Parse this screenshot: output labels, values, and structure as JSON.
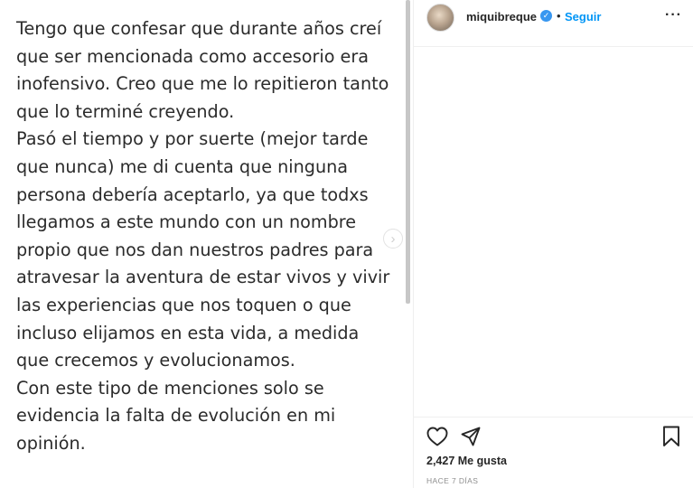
{
  "post": {
    "text_lines": [
      "Tengo que confesar que durante años creí",
      "que ser mencionada como accesorio era",
      "inofensivo. Creo que me lo repitieron tanto",
      "que lo terminé creyendo.",
      "Pasó el tiempo y por suerte (mejor tarde",
      "que nunca) me di cuenta que ninguna",
      "persona debería aceptarlo, ya que todxs",
      "llegamos a este mundo con un nombre",
      "propio que nos dan nuestros padres para",
      "atravesar la aventura de estar vivos y vivir",
      "las experiencias que nos toquen o que",
      "incluso elijamos en esta vida, a medida",
      "que crecemos y evolucionamos.",
      "Con este tipo de menciones solo se",
      "evidencia la falta de evolución en mi",
      "opinión."
    ],
    "next_arrow_glyph": "›"
  },
  "header": {
    "username": "miquibreque",
    "verified_glyph": "✓",
    "separator": "•",
    "follow_label": "Seguir",
    "more_glyph": "···"
  },
  "actions": {
    "icons": [
      "heart-icon",
      "share-icon",
      "save-icon"
    ]
  },
  "likes": {
    "text": "2,427 Me gusta"
  },
  "timestamp": {
    "text": "HACE 7 DÍAS"
  },
  "colors": {
    "link_blue": "#0095f6",
    "verified_blue": "#3897f0",
    "text_dark": "#262626",
    "text_muted": "#8e8e8e",
    "divider": "#efefef"
  }
}
